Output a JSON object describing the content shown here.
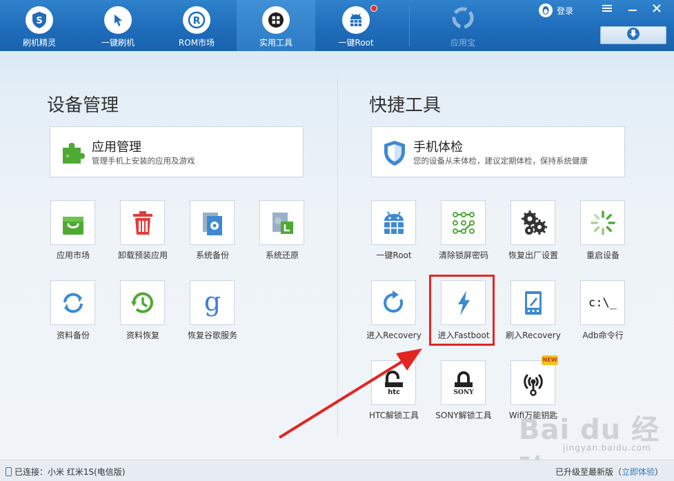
{
  "nav": {
    "tabs": [
      {
        "label": "刷机精灵",
        "icon": "shield-s-icon"
      },
      {
        "label": "一键刷机",
        "icon": "cursor-icon"
      },
      {
        "label": "ROM市场",
        "icon": "r-logo-icon"
      },
      {
        "label": "实用工具",
        "icon": "grid-icon"
      },
      {
        "label": "一键Root",
        "icon": "android-root-icon"
      }
    ],
    "active_tab": "实用工具",
    "app_store": "应用宝",
    "login": "登录"
  },
  "left": {
    "title": "设备管理",
    "feature": {
      "title": "应用管理",
      "subtitle": "管理手机上安装的应用及游戏"
    },
    "tools": [
      {
        "label": "应用市场",
        "icon": "shopping-bag-icon"
      },
      {
        "label": "卸载预装应用",
        "icon": "trash-icon"
      },
      {
        "label": "系统备份",
        "icon": "system-backup-icon"
      },
      {
        "label": "系统还原",
        "icon": "system-restore-icon"
      },
      {
        "label": "资料备份",
        "icon": "sync-icon"
      },
      {
        "label": "资料恢复",
        "icon": "history-clock-icon"
      },
      {
        "label": "恢复谷歌服务",
        "icon": "google-g-icon"
      }
    ]
  },
  "right": {
    "title": "快捷工具",
    "feature": {
      "title": "手机体检",
      "subtitle": "您的设备从未体检，建议定期体检，保持系统健康"
    },
    "tools": [
      {
        "label": "一键Root",
        "icon": "android-root-icon"
      },
      {
        "label": "清除锁屏密码",
        "icon": "pattern-lock-icon"
      },
      {
        "label": "恢复出厂设置",
        "icon": "gears-icon"
      },
      {
        "label": "重启设备",
        "icon": "loading-spinner-icon"
      },
      {
        "label": "进入Recovery",
        "icon": "refresh-arrow-icon"
      },
      {
        "label": "进入Fastboot",
        "icon": "lightning-icon"
      },
      {
        "label": "刷入Recovery",
        "icon": "tablet-edit-icon"
      },
      {
        "label": "Adb命令行",
        "icon": "terminal-icon",
        "glyph": "c:\\_"
      },
      {
        "label": "HTC解锁工具",
        "icon": "htc-unlock-icon",
        "brand": "htc"
      },
      {
        "label": "SONY解锁工具",
        "icon": "sony-unlock-icon",
        "brand": "SONY"
      },
      {
        "label": "Wifi万能钥匙",
        "icon": "wifi-key-icon",
        "badge": "NEW"
      }
    ]
  },
  "status": {
    "connected": "已连接：小米 红米1S(电信版)",
    "upgrade": "已升级至最新版（",
    "upgrade_link": "立即体验",
    "upgrade_end": "）"
  },
  "watermark": {
    "brand": "Bai du 经验",
    "url": "jingyan.baidu.com"
  },
  "colors": {
    "accent": "#1f6dbb",
    "highlight": "#e42421",
    "link": "#2d7ac4"
  }
}
